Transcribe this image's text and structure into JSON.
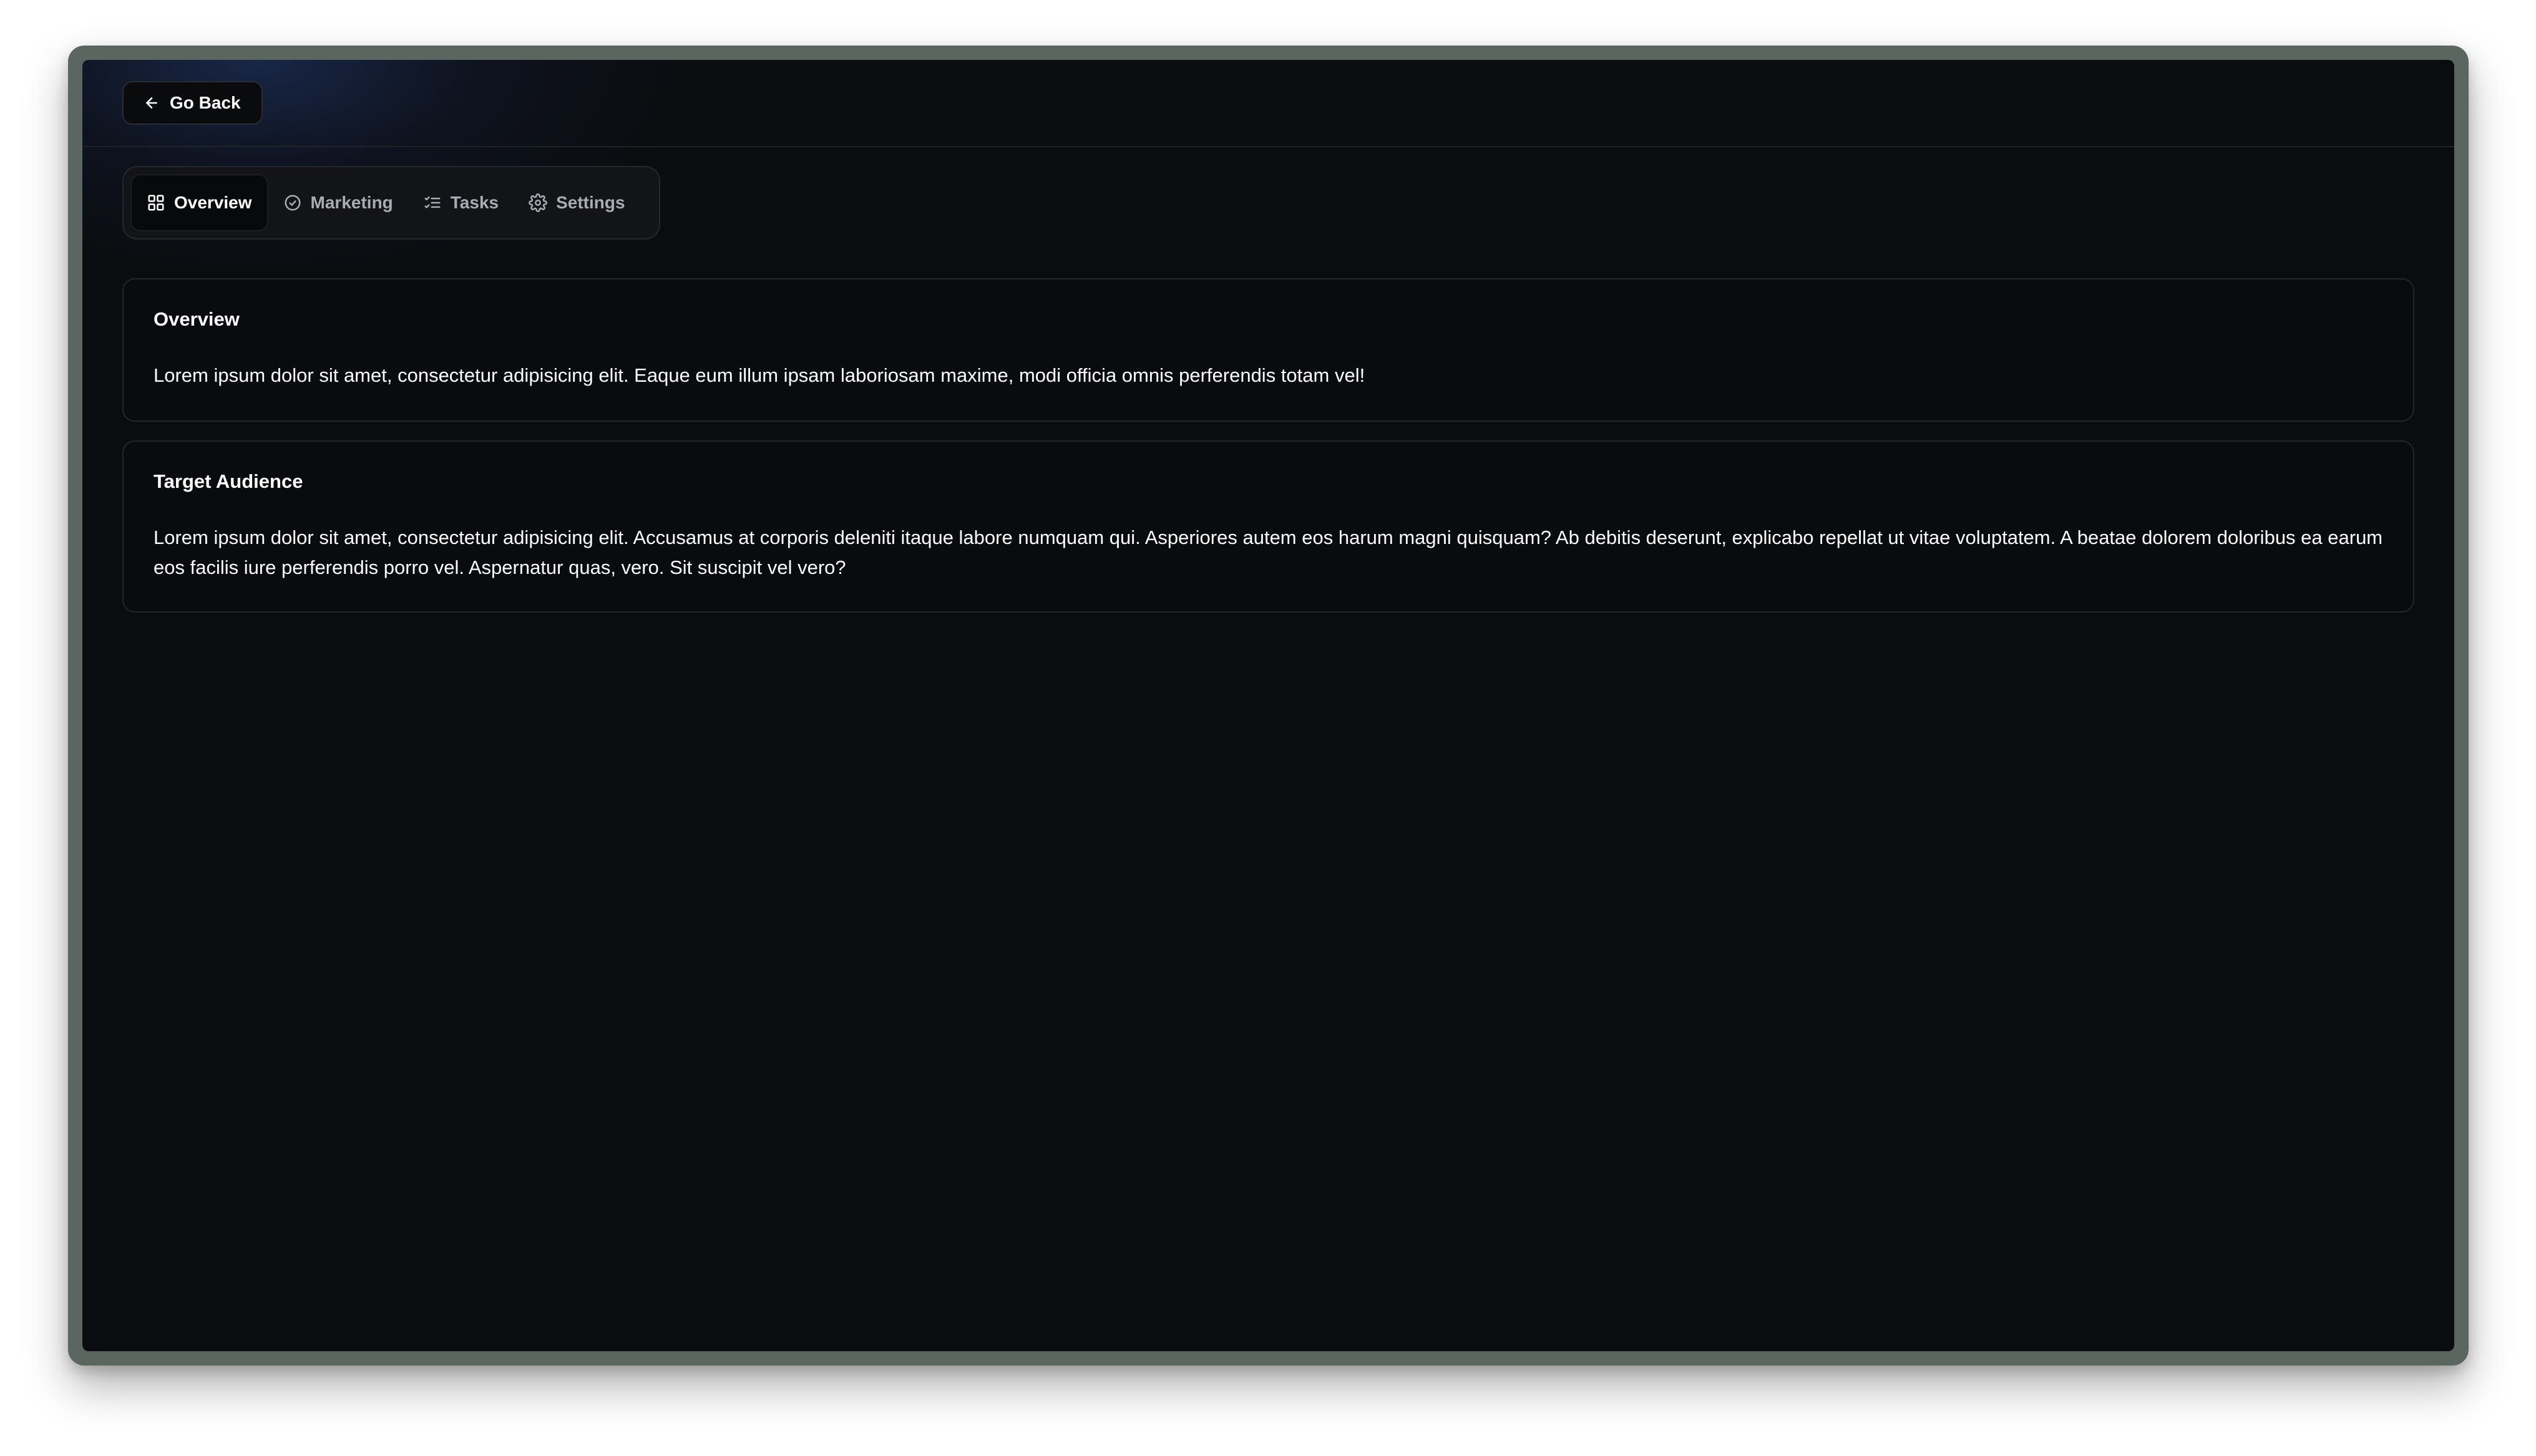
{
  "header": {
    "back_label": "Go Back",
    "back_icon": "arrow-left-icon"
  },
  "tabs": [
    {
      "label": "Overview",
      "icon": "layout-grid-icon",
      "active": true
    },
    {
      "label": "Marketing",
      "icon": "circle-check-icon",
      "active": false
    },
    {
      "label": "Tasks",
      "icon": "list-checks-icon",
      "active": false
    },
    {
      "label": "Settings",
      "icon": "gear-icon",
      "active": false
    }
  ],
  "sections": [
    {
      "title": "Overview",
      "body": "Lorem ipsum dolor sit amet, consectetur adipisicing elit. Eaque eum illum ipsam laboriosam maxime, modi officia omnis perferendis totam vel!"
    },
    {
      "title": "Target Audience",
      "body": "Lorem ipsum dolor sit amet, consectetur adipisicing elit. Accusamus at corporis deleniti itaque labore numquam qui. Asperiores autem eos harum magni quisquam? Ab debitis deserunt, explicabo repellat ut vitae voluptatem. A beatae dolorem doloribus ea earum eos facilis iure perferendis porro vel. Aspernatur quas, vero. Sit suscipit vel vero?"
    }
  ],
  "colors": {
    "background": "#0b0c0f",
    "device_frame": "#5c6661",
    "text_primary": "#ffffff",
    "text_muted": "#a9acb3",
    "border": "#22252a"
  }
}
